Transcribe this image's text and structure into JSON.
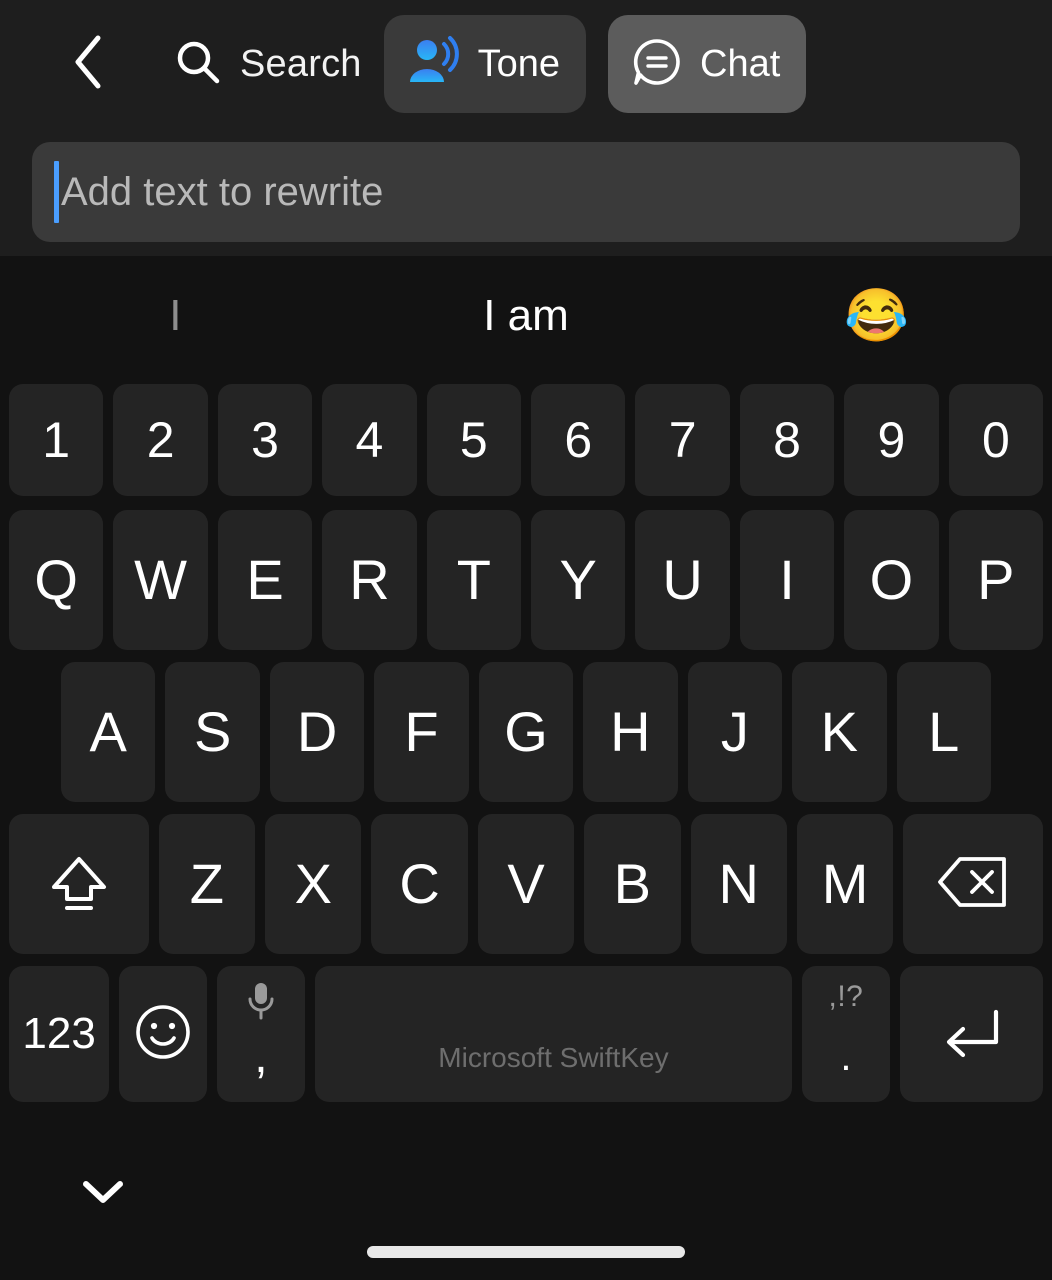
{
  "toolbar": {
    "back_icon": "chevron-left-icon",
    "search_icon": "search-icon",
    "search_label": "Search",
    "tone_icon": "person-sound-waves-icon",
    "tone_label": "Tone",
    "chat_icon": "chat-bubble-equals-icon",
    "chat_label": "Chat",
    "tone_bg": "#3a3a3a",
    "chat_bg": "#5c5c5c",
    "toolbar_bg": "#1e1e1e",
    "selected": "Chat"
  },
  "rewrite_input": {
    "placeholder": "Add text to rewrite",
    "value": "",
    "caret_color": "#4a9eff",
    "field_bg": "#3a3a3a"
  },
  "suggestions": [
    {
      "label": "I",
      "style": "dim"
    },
    {
      "label": "I am",
      "style": "bright"
    },
    {
      "label": "😂",
      "style": "emoji"
    }
  ],
  "keyboard": {
    "app_name": "Microsoft SwiftKey",
    "key_bg": "#242424",
    "keyboard_bg": "#121212",
    "rows": {
      "numbers": [
        "1",
        "2",
        "3",
        "4",
        "5",
        "6",
        "7",
        "8",
        "9",
        "0"
      ],
      "top": [
        "Q",
        "W",
        "E",
        "R",
        "T",
        "Y",
        "U",
        "I",
        "O",
        "P"
      ],
      "home": [
        "A",
        "S",
        "D",
        "F",
        "G",
        "H",
        "J",
        "K",
        "L"
      ],
      "bottom": [
        "Z",
        "X",
        "C",
        "V",
        "B",
        "N",
        "M"
      ]
    },
    "shift_icon": "shift-caps-icon",
    "backspace_icon": "backspace-delete-icon",
    "numeric_label": "123",
    "emoji_icon": "smiley-face-icon",
    "mic_icon": "microphone-icon",
    "comma_label": ",",
    "space_label": "Microsoft SwiftKey",
    "punct_alt_label": ",!?",
    "period_label": ".",
    "enter_icon": "enter-return-icon"
  },
  "bottombar": {
    "dismiss_icon": "chevron-down-icon",
    "home_indicator": "home-indicator-bar"
  }
}
